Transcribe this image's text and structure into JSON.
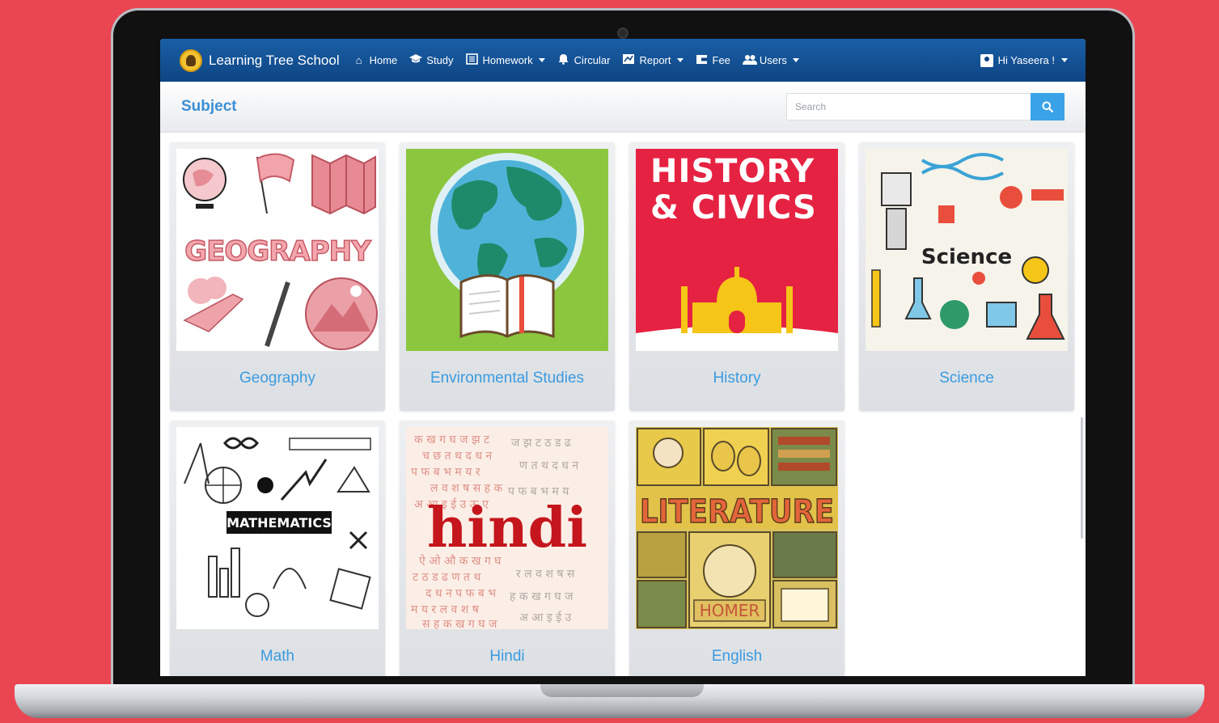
{
  "brand": {
    "name": "Learning Tree School"
  },
  "nav": {
    "items": [
      {
        "label": "Home",
        "icon": "home-icon",
        "dropdown": false
      },
      {
        "label": "Study",
        "icon": "graduation-cap-icon",
        "dropdown": false
      },
      {
        "label": "Homework",
        "icon": "book-icon",
        "dropdown": true
      },
      {
        "label": "Circular",
        "icon": "bell-icon",
        "dropdown": false
      },
      {
        "label": "Report",
        "icon": "report-icon",
        "dropdown": true
      },
      {
        "label": "Fee",
        "icon": "wallet-icon",
        "dropdown": false
      },
      {
        "label": "Users",
        "icon": "users-icon",
        "dropdown": true
      }
    ],
    "user_greeting": "Hi Yaseera !"
  },
  "page": {
    "title": "Subject"
  },
  "search": {
    "placeholder": "Search"
  },
  "subjects": [
    {
      "label": "Geography",
      "image_text": "GEOGRAPHY"
    },
    {
      "label": "Environmental Studies",
      "image_text": ""
    },
    {
      "label": "History",
      "image_text": "HISTORY & CIVICS"
    },
    {
      "label": "Science",
      "image_text": "Science"
    },
    {
      "label": "Math",
      "image_text": "MATHEMATICS"
    },
    {
      "label": "Hindi",
      "image_text": "hindi"
    },
    {
      "label": "English",
      "image_text": "LITERATURE",
      "image_subtext": "HOMER"
    }
  ],
  "colors": {
    "background": "#e94652",
    "navbar": "#0e4584",
    "accent": "#3b9be0",
    "search_button": "#3aa3e8"
  }
}
